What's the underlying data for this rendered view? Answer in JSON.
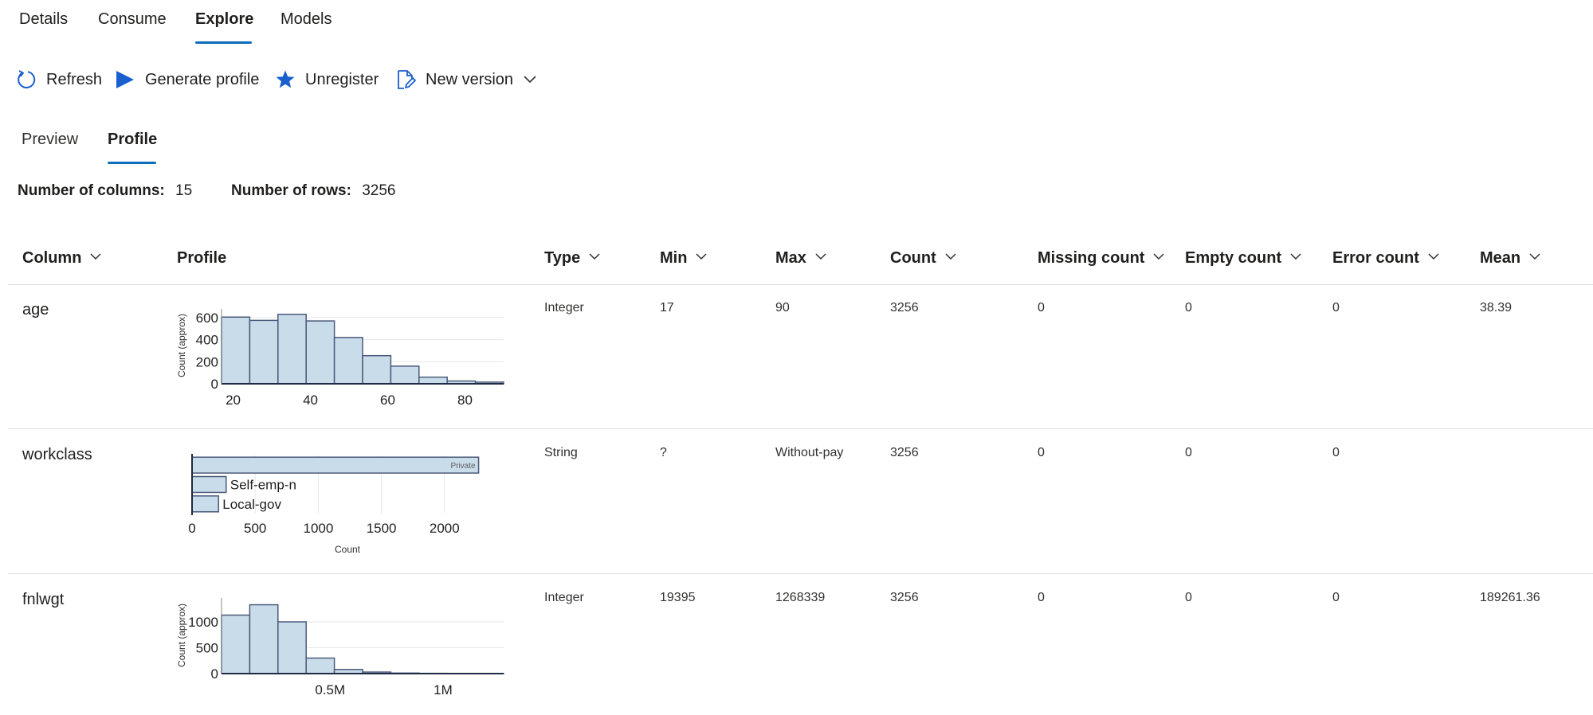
{
  "tabs": {
    "items": [
      "Details",
      "Consume",
      "Explore",
      "Models"
    ],
    "active": "Explore"
  },
  "toolbar": {
    "refresh": "Refresh",
    "generate_profile": "Generate profile",
    "unregister": "Unregister",
    "new_version": "New version"
  },
  "subtabs": {
    "items": [
      "Preview",
      "Profile"
    ],
    "active": "Profile"
  },
  "summary": {
    "columns_label": "Number of columns:",
    "columns_value": "15",
    "rows_label": "Number of rows:",
    "rows_value": "3256"
  },
  "table": {
    "headers": {
      "column": "Column",
      "profile": "Profile",
      "type": "Type",
      "min": "Min",
      "max": "Max",
      "count": "Count",
      "missing": "Missing count",
      "empty": "Empty count",
      "error": "Error count",
      "mean": "Mean"
    },
    "rows": [
      {
        "column": "age",
        "type": "Integer",
        "min": "17",
        "max": "90",
        "count": "3256",
        "missing": "0",
        "empty": "0",
        "error": "0",
        "mean": "38.39"
      },
      {
        "column": "workclass",
        "type": "String",
        "min": "?",
        "max": "Without-pay",
        "count": "3256",
        "missing": "0",
        "empty": "0",
        "error": "0",
        "mean": ""
      },
      {
        "column": "fnlwgt",
        "type": "Integer",
        "min": "19395",
        "max": "1268339",
        "count": "3256",
        "missing": "0",
        "empty": "0",
        "error": "0",
        "mean": "189261.36"
      }
    ]
  },
  "chart_data": [
    {
      "type": "bar",
      "title": "",
      "xlabel": "",
      "ylabel": "Count (approx)",
      "x_bins": [
        [
          17,
          24.3
        ],
        [
          24.3,
          31.6
        ],
        [
          31.6,
          38.9
        ],
        [
          38.9,
          46.2
        ],
        [
          46.2,
          53.5
        ],
        [
          53.5,
          60.8
        ],
        [
          60.8,
          68.1
        ],
        [
          68.1,
          75.4
        ],
        [
          75.4,
          82.7
        ],
        [
          82.7,
          90
        ]
      ],
      "values": [
        605,
        575,
        630,
        570,
        420,
        255,
        160,
        60,
        25,
        15
      ],
      "xticks": [
        "20",
        "40",
        "60",
        "80"
      ],
      "yticks": [
        "0",
        "200",
        "400",
        "600"
      ],
      "xlim": [
        17,
        90
      ],
      "ylim": [
        0,
        650
      ],
      "grid": true,
      "bar_color": "#c9dcea",
      "bar_edge": "#4b5a7a"
    },
    {
      "type": "bar",
      "orientation": "horizontal",
      "title": "",
      "xlabel": "Count",
      "ylabel": "",
      "categories": [
        "Private",
        "Self-emp-n",
        "Local-gov"
      ],
      "values": [
        2270,
        270,
        210
      ],
      "xticks": [
        "0",
        "500",
        "1000",
        "1500",
        "2000"
      ],
      "xlim": [
        0,
        2380
      ],
      "grid": true,
      "bar_color": "#c9dcea",
      "bar_edge": "#4b5a7a"
    },
    {
      "type": "bar",
      "title": "",
      "xlabel": "",
      "ylabel": "Count (approx)",
      "x_bins": [
        [
          19395,
          144289
        ],
        [
          144289,
          269184
        ],
        [
          269184,
          394078
        ],
        [
          394078,
          518973
        ],
        [
          518973,
          643867
        ],
        [
          643867,
          768762
        ],
        [
          768762,
          893656
        ],
        [
          893656,
          1018550
        ],
        [
          1018550,
          1143445
        ],
        [
          1143445,
          1268339
        ]
      ],
      "values": [
        1130,
        1330,
        1000,
        300,
        80,
        30,
        10,
        5,
        3,
        2
      ],
      "xticks": [
        "0.5M",
        "1M"
      ],
      "yticks": [
        "0",
        "500",
        "1000"
      ],
      "xlim": [
        19395,
        1268339
      ],
      "ylim": [
        0,
        1400
      ],
      "grid": true,
      "bar_color": "#c9dcea",
      "bar_edge": "#4b5a7a"
    }
  ],
  "colors": {
    "accent": "#0f6cbd",
    "icon_blue": "#1a5fce",
    "divider": "#e1dfdd",
    "bar_fill": "#c9dcea",
    "bar_edge": "#4b5a7a"
  }
}
